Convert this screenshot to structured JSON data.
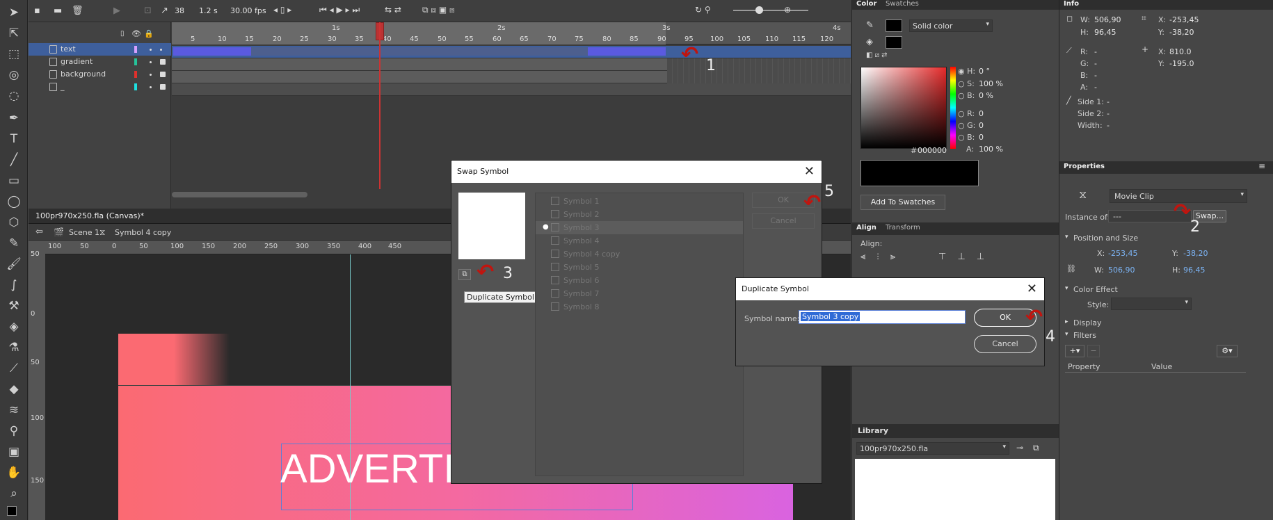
{
  "timeline": {
    "current_frame": "38",
    "time": "1.2 s",
    "fps": "30.00 fps",
    "layers": [
      {
        "name": "text",
        "color": "#d6a0ff"
      },
      {
        "name": "gradient",
        "color": "#26c39a"
      },
      {
        "name": "background",
        "color": "#e0302c"
      },
      {
        "name": "_",
        "color": "#1fe0e0"
      }
    ],
    "seconds_labels": [
      "1s",
      "2s",
      "3s",
      "4s"
    ],
    "frame_ticks": [
      "5",
      "10",
      "15",
      "20",
      "25",
      "30",
      "35",
      "40",
      "45",
      "50",
      "55",
      "60",
      "65",
      "70",
      "75",
      "80",
      "85",
      "90",
      "95",
      "100",
      "105",
      "110",
      "115",
      "120"
    ]
  },
  "document": {
    "tab": "100pr970x250.fla (Canvas)*",
    "scene": "Scene 1",
    "symbol": "Symbol 4 copy",
    "h_ruler": [
      "100",
      "50",
      "0",
      "50",
      "100",
      "150",
      "200",
      "250",
      "300",
      "350",
      "400",
      "450"
    ],
    "v_ruler": [
      "50",
      "0",
      "50",
      "100",
      "150"
    ],
    "canvas_text": "ADVERTISING TEXT"
  },
  "color_panel": {
    "tabs": [
      "Color",
      "Swatches"
    ],
    "fill_type": "Solid color",
    "h": {
      "label": "H:",
      "value": "0",
      "unit": "°"
    },
    "s": {
      "label": "S:",
      "value": "100",
      "unit": "%"
    },
    "b": {
      "label": "B:",
      "value": "0",
      "unit": "%"
    },
    "r": {
      "label": "R:",
      "value": "0"
    },
    "g": {
      "label": "G:",
      "value": "0"
    },
    "bb": {
      "label": "B:",
      "value": "0"
    },
    "a": {
      "label": "A:",
      "value": "100",
      "unit": "%"
    },
    "hex_label": "#",
    "hex": "000000",
    "add_swatches": "Add To Swatches"
  },
  "align_panel": {
    "tabs": [
      "Align",
      "Transform"
    ],
    "align_label": "Align:"
  },
  "library": {
    "title": "Library",
    "file": "100pr970x250.fla"
  },
  "info": {
    "title": "Info",
    "w_label": "W:",
    "w": "506,90",
    "h_label": "H:",
    "h": "96,45",
    "x_label": "X:",
    "x": "-253,45",
    "y_label": "Y:",
    "y": "-38,20",
    "r_label": "R:",
    "r": "-",
    "g_label": "G:",
    "g": "-",
    "b_label": "B:",
    "b": "-",
    "a_label": "A:",
    "a": "-",
    "mx_label": "X:",
    "mx": "810.0",
    "my_label": "Y:",
    "my": "-195.0",
    "side1_label": "Side 1:",
    "side1": "-",
    "side2_label": "Side 2:",
    "side2": "-",
    "width_label": "Width:",
    "width": "-"
  },
  "properties": {
    "title": "Properties",
    "type": "Movie Clip",
    "instance_label": "Instance of:",
    "instance_value": "---",
    "swap_label": "Swap...",
    "pos_size": "Position and Size",
    "x_label": "X:",
    "x": "-253,45",
    "y_label": "Y:",
    "y": "-38,20",
    "w_label": "W:",
    "w": "506,90",
    "h_label": "H:",
    "h": "96,45",
    "color_effect": "Color Effect",
    "style_label": "Style:",
    "display": "Display",
    "filters": "Filters",
    "col_property": "Property",
    "col_value": "Value"
  },
  "swap_dialog": {
    "title": "Swap Symbol",
    "ok": "OK",
    "cancel": "Cancel",
    "duplicate_tooltip": "Duplicate Symbol",
    "symbols": [
      "Symbol 1",
      "Symbol 2",
      "Symbol 3",
      "Symbol 4",
      "Symbol 4 copy",
      "Symbol 5",
      "Symbol 6",
      "Symbol 7",
      "Symbol 8"
    ],
    "selected_index": 2
  },
  "duplicate_dialog": {
    "title": "Duplicate Symbol",
    "name_label": "Symbol name:",
    "name_value": "Symbol 3 copy",
    "ok": "OK",
    "cancel": "Cancel"
  },
  "annotations": [
    "1",
    "2",
    "3",
    "4",
    "5"
  ]
}
